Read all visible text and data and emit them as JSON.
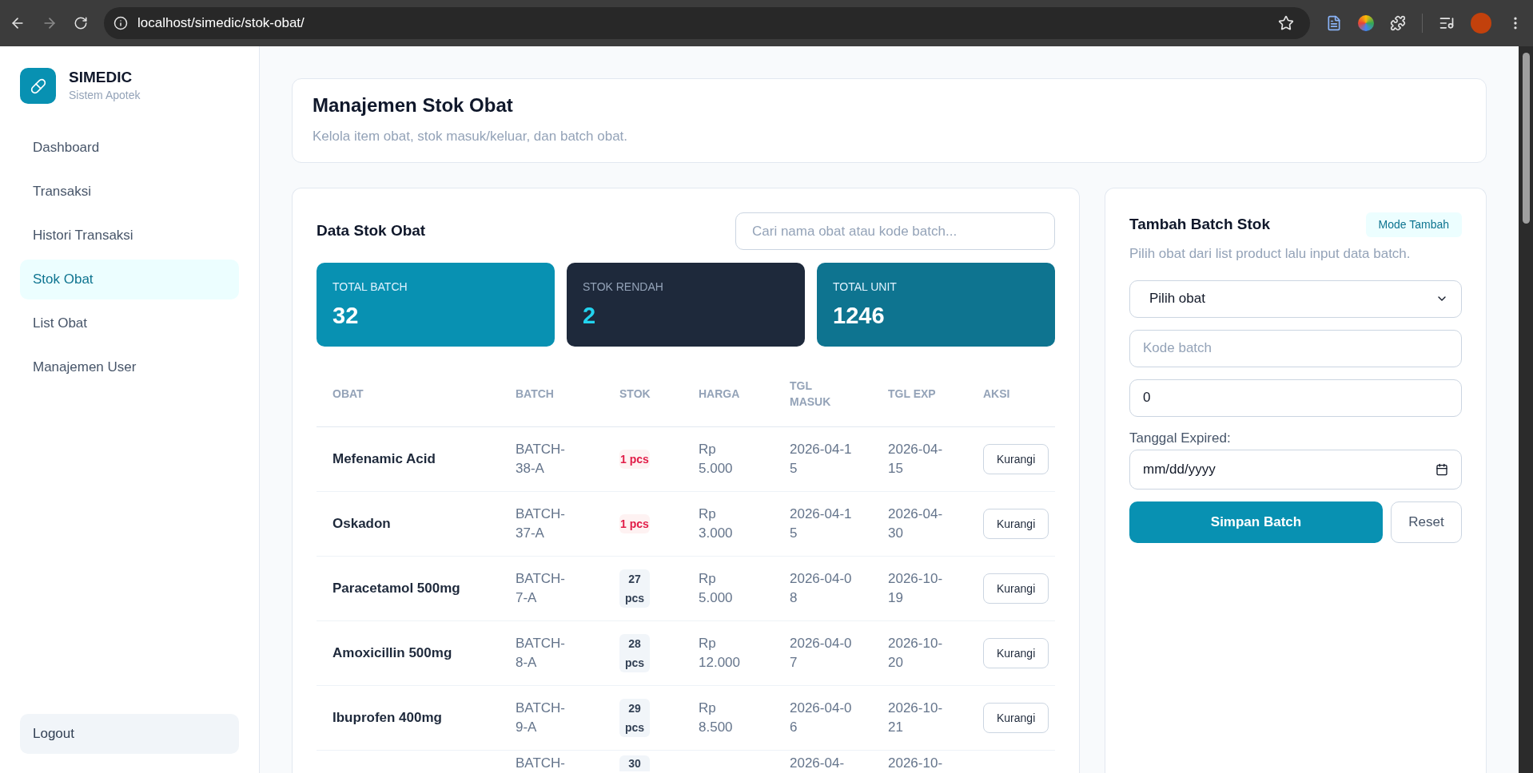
{
  "browser": {
    "url": "localhost/simedic/stok-obat/"
  },
  "sidebar": {
    "brand": "SIMEDIC",
    "subtitle": "Sistem Apotek",
    "items": [
      {
        "label": "Dashboard",
        "selected": false
      },
      {
        "label": "Transaksi",
        "selected": false
      },
      {
        "label": "Histori Transaksi",
        "selected": false
      },
      {
        "label": "Stok Obat",
        "selected": true
      },
      {
        "label": "List Obat",
        "selected": false
      },
      {
        "label": "Manajemen User",
        "selected": false
      }
    ],
    "logout": "Logout"
  },
  "header": {
    "title": "Manajemen Stok Obat",
    "subtitle": "Kelola item obat, stok masuk/keluar, dan batch obat."
  },
  "stock_panel": {
    "title": "Data Stok Obat",
    "search": {
      "placeholder": "Cari nama obat atau kode batch..."
    },
    "stats": [
      {
        "label": "TOTAL BATCH",
        "value": "32",
        "kind": "primary"
      },
      {
        "label": "STOK RENDAH",
        "value": "2",
        "kind": "dark"
      },
      {
        "label": "TOTAL UNIT",
        "value": "1246",
        "kind": "deep"
      }
    ],
    "table": {
      "columns": [
        "OBAT",
        "BATCH",
        "STOK",
        "HARGA",
        "TGL MASUK",
        "TGL EXP",
        "AKSI"
      ],
      "rows": [
        {
          "obat": "Mefenamic Acid",
          "batch": "BATCH-38-A",
          "stok": "1 pcs",
          "low_stock": true,
          "harga": "Rp 5.000",
          "tgl_masuk": "2026-04-15",
          "tgl_exp": "2026-04-15",
          "action": "Kurangi"
        },
        {
          "obat": "Oskadon",
          "batch": "BATCH-37-A",
          "stok": "1 pcs",
          "low_stock": true,
          "harga": "Rp 3.000",
          "tgl_masuk": "2026-04-15",
          "tgl_exp": "2026-04-30",
          "action": "Kurangi"
        },
        {
          "obat": "Paracetamol 500mg",
          "batch": "BATCH-7-A",
          "stok": "27 pcs",
          "low_stock": false,
          "harga": "Rp 5.000",
          "tgl_masuk": "2026-04-08",
          "tgl_exp": "2026-10-19",
          "action": "Kurangi"
        },
        {
          "obat": "Amoxicillin 500mg",
          "batch": "BATCH-8-A",
          "stok": "28 pcs",
          "low_stock": false,
          "harga": "Rp 12.000",
          "tgl_masuk": "2026-04-07",
          "tgl_exp": "2026-10-20",
          "action": "Kurangi"
        },
        {
          "obat": "Ibuprofen 400mg",
          "batch": "BATCH-9-A",
          "stok": "29 pcs",
          "low_stock": false,
          "harga": "Rp 8.500",
          "tgl_masuk": "2026-04-06",
          "tgl_exp": "2026-10-21",
          "action": "Kurangi"
        }
      ],
      "partial_row": {
        "batch": "BATCH-",
        "stok": "30",
        "tgl_masuk": "2026-04-",
        "tgl_exp": "2026-10-"
      }
    }
  },
  "form": {
    "title": "Tambah Batch Stok",
    "mode_badge": "Mode Tambah",
    "subtitle": "Pilih obat dari list product lalu input data batch.",
    "select": {
      "value": "Pilih obat"
    },
    "batch_code": {
      "placeholder": "Kode batch"
    },
    "quantity": {
      "value": "0"
    },
    "expiry_label": "Tanggal Expired:",
    "expiry": {
      "placeholder": "mm/dd/yyyy"
    },
    "submit": "Simpan Batch",
    "reset": "Reset"
  }
}
